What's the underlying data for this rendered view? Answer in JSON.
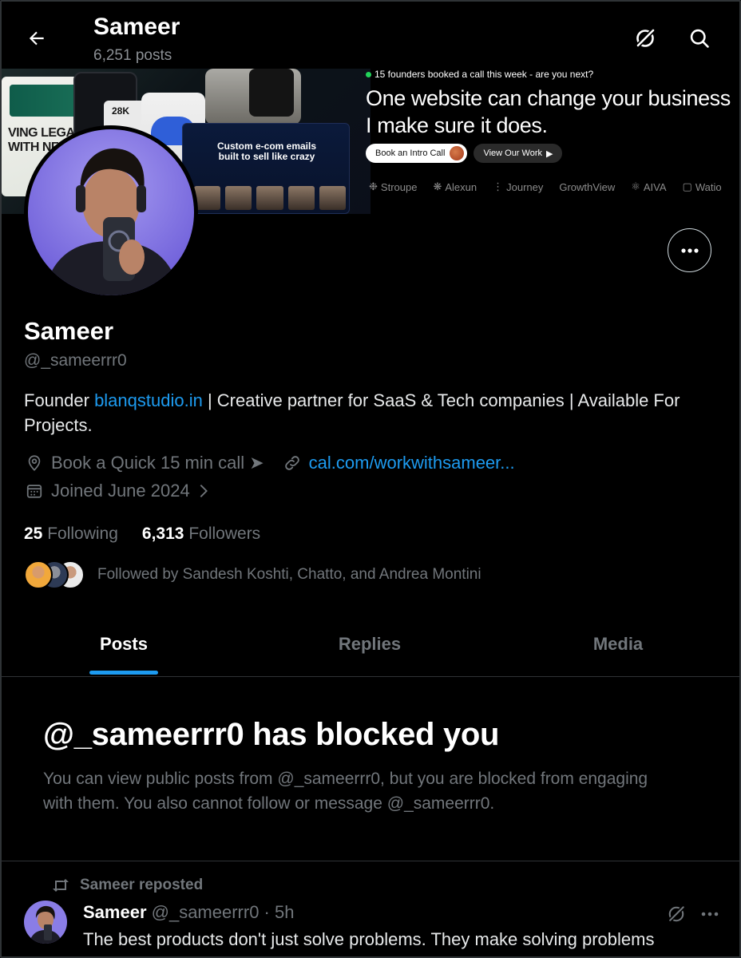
{
  "header": {
    "name": "Sameer",
    "post_count": "6,251 posts",
    "back_icon": "arrow-left-icon",
    "grok_icon": "grok-icon",
    "search_icon": "search-icon"
  },
  "banner": {
    "live_text": "15 founders booked a call this week - are you next?",
    "headline_line1": "One website can change your business",
    "headline_line2": "I make sure it does.",
    "button_intro": "Book an Intro Call",
    "button_work": "View Our Work",
    "logos": [
      "Stroupe",
      "Alexun",
      "Journey",
      "GrowthView",
      "AIVA",
      "Watio"
    ],
    "mock_card_heading": "Custom e-com emails built to sell like crazy",
    "mock_card_text": "VING LEGA TERS WITH NFIDENCE",
    "mock_stat": "28K"
  },
  "profile": {
    "name": "Sameer",
    "handle": "@_sameerrr0",
    "bio_prefix": "Founder ",
    "bio_link": "blanqstudio.in",
    "bio_suffix": " | Creative partner for SaaS & Tech companies | Available For Projects.",
    "location": "Book a Quick 15 min call ➤",
    "website": "cal.com/workwithsameer...",
    "joined": "Joined June 2024",
    "following_count": "25",
    "following_label": "Following",
    "followers_count": "6,313",
    "followers_label": "Followers",
    "followed_by": "Followed by Sandesh Koshti, Chatto, and Andrea Montini"
  },
  "tabs": [
    {
      "label": "Posts",
      "active": true
    },
    {
      "label": "Replies",
      "active": false
    },
    {
      "label": "Media",
      "active": false
    }
  ],
  "blocked": {
    "title": "@_sameerrr0 has blocked you",
    "body": "You can view public posts from @_sameerrr0, but you are blocked from engaging with them. You also cannot follow or message @_sameerrr0."
  },
  "post": {
    "repost_label": "Sameer reposted",
    "author_name": "Sameer",
    "author_meta": " @_sameerrr0 · 5h",
    "text": "The best products don't just solve problems. They make solving problems"
  },
  "colors": {
    "accent": "#1d9bf0",
    "muted": "#71767b",
    "text": "#e7e9ea",
    "background": "#000000",
    "border": "#2f3336",
    "live_dot": "#22d35a"
  }
}
